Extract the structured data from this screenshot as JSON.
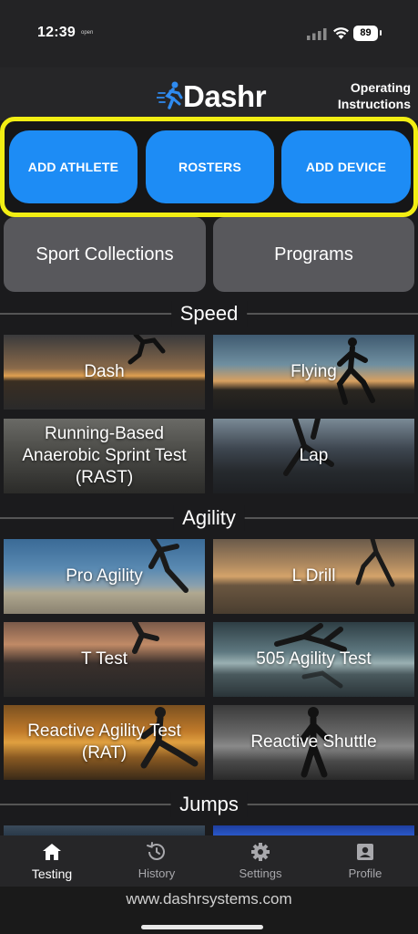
{
  "status_bar": {
    "time": "12:39",
    "open_tag": "open",
    "battery": "89"
  },
  "header": {
    "logo_text": "Dashr",
    "operating_instructions": "Operating Instructions"
  },
  "primary_buttons": {
    "add_athlete": "ADD ATHLETE",
    "rosters": "ROSTERS",
    "add_device": "ADD DEVICE"
  },
  "secondary_buttons": {
    "sport_collections": "Sport Collections",
    "programs": "Programs"
  },
  "sections": {
    "speed": {
      "title": "Speed",
      "tiles": [
        "Dash",
        "Flying",
        "Running-Based Anaerobic Sprint Test (RAST)",
        "Lap"
      ]
    },
    "agility": {
      "title": "Agility",
      "tiles": [
        "Pro Agility",
        "L Drill",
        "T Test",
        "505 Agility Test",
        "Reactive Agility Test (RAT)",
        "Reactive Shuttle"
      ]
    },
    "jumps": {
      "title": "Jumps"
    }
  },
  "bottom_nav": {
    "items": [
      {
        "label": "Testing",
        "icon": "home-icon",
        "active": true
      },
      {
        "label": "History",
        "icon": "history-icon",
        "active": false
      },
      {
        "label": "Settings",
        "icon": "gear-icon",
        "active": false
      },
      {
        "label": "Profile",
        "icon": "profile-icon",
        "active": false
      }
    ]
  },
  "url_bar": {
    "url": "www.dashrsystems.com"
  },
  "colors": {
    "accent_blue": "#1d8cf5",
    "highlight_yellow": "#f2ee13",
    "secondary_button": "#58585c",
    "background": "#1b1b1d"
  }
}
